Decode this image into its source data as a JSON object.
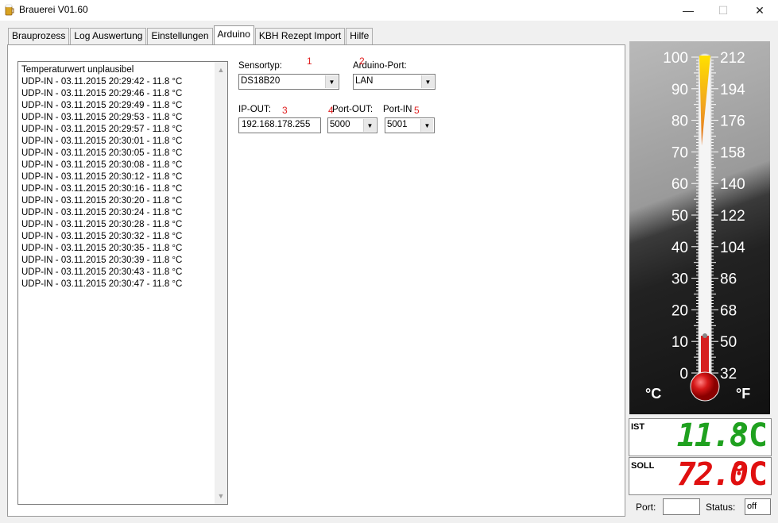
{
  "window": {
    "title": "Brauerei V01.60",
    "minimize_glyph": "—",
    "maximize_glyph": "☐",
    "close_glyph": "✕"
  },
  "tabs": [
    {
      "label": "Brauprozess"
    },
    {
      "label": "Log Auswertung"
    },
    {
      "label": "Einstellungen"
    },
    {
      "label": "Arduino",
      "active": true
    },
    {
      "label": "KBH Rezept Import"
    },
    {
      "label": "Hilfe"
    }
  ],
  "log": {
    "lines": [
      "Temperaturwert unplausibel",
      "UDP-IN - 03.11.2015 20:29:42 - 11.8 °C",
      "UDP-IN - 03.11.2015 20:29:46 - 11.8 °C",
      "UDP-IN - 03.11.2015 20:29:49 - 11.8 °C",
      "UDP-IN - 03.11.2015 20:29:53 - 11.8 °C",
      "UDP-IN - 03.11.2015 20:29:57 - 11.8 °C",
      "UDP-IN - 03.11.2015 20:30:01 - 11.8 °C",
      "UDP-IN - 03.11.2015 20:30:05 - 11.8 °C",
      "UDP-IN - 03.11.2015 20:30:08 - 11.8 °C",
      "UDP-IN - 03.11.2015 20:30:12 - 11.8 °C",
      "UDP-IN - 03.11.2015 20:30:16 - 11.8 °C",
      "UDP-IN - 03.11.2015 20:30:20 - 11.8 °C",
      "UDP-IN - 03.11.2015 20:30:24 - 11.8 °C",
      "UDP-IN - 03.11.2015 20:30:28 - 11.8 °C",
      "UDP-IN - 03.11.2015 20:30:32 - 11.8 °C",
      "UDP-IN - 03.11.2015 20:30:35 - 11.8 °C",
      "UDP-IN - 03.11.2015 20:30:39 - 11.8 °C",
      "UDP-IN - 03.11.2015 20:30:43 - 11.8 °C",
      "UDP-IN - 03.11.2015 20:30:47 - 11.8 °C"
    ],
    "scroll_up": "▲",
    "scroll_down": "▼"
  },
  "settings": {
    "sensortyp": {
      "label": "Sensortyp:",
      "value": "DS18B20",
      "marker": "1"
    },
    "arduino_port": {
      "label": "Arduino-Port:",
      "value": "LAN",
      "marker": "2"
    },
    "ip_out": {
      "label": "IP-OUT:",
      "value": "192.168.178.255",
      "marker": "3"
    },
    "port_out": {
      "label": "Port-OUT:",
      "value": "5000",
      "marker": "4"
    },
    "port_in": {
      "label": "Port-IN",
      "value": "5001",
      "marker": "5"
    },
    "dropdown_glyph": "▼"
  },
  "thermometer": {
    "celsius_labels": [
      "100",
      "90",
      "80",
      "70",
      "60",
      "50",
      "40",
      "30",
      "20",
      "10",
      "0"
    ],
    "fahrenheit_labels": [
      "212",
      "194",
      "176",
      "158",
      "140",
      "122",
      "104",
      "86",
      "68",
      "50",
      "32"
    ],
    "celsius_unit": "°C",
    "fahrenheit_unit": "°F",
    "current_celsius": 11.8,
    "target_celsius": 72.0,
    "range_celsius": [
      0,
      100
    ]
  },
  "ist": {
    "label": "IST",
    "value": "11.8",
    "unit": "°C",
    "color": "#1fa11f"
  },
  "soll": {
    "label": "SOLL",
    "value": "72.0",
    "unit": "°C",
    "color": "#e01010"
  },
  "footer": {
    "port_label": "Port:",
    "port_value": "",
    "status_label": "Status:",
    "status_value": "off"
  }
}
